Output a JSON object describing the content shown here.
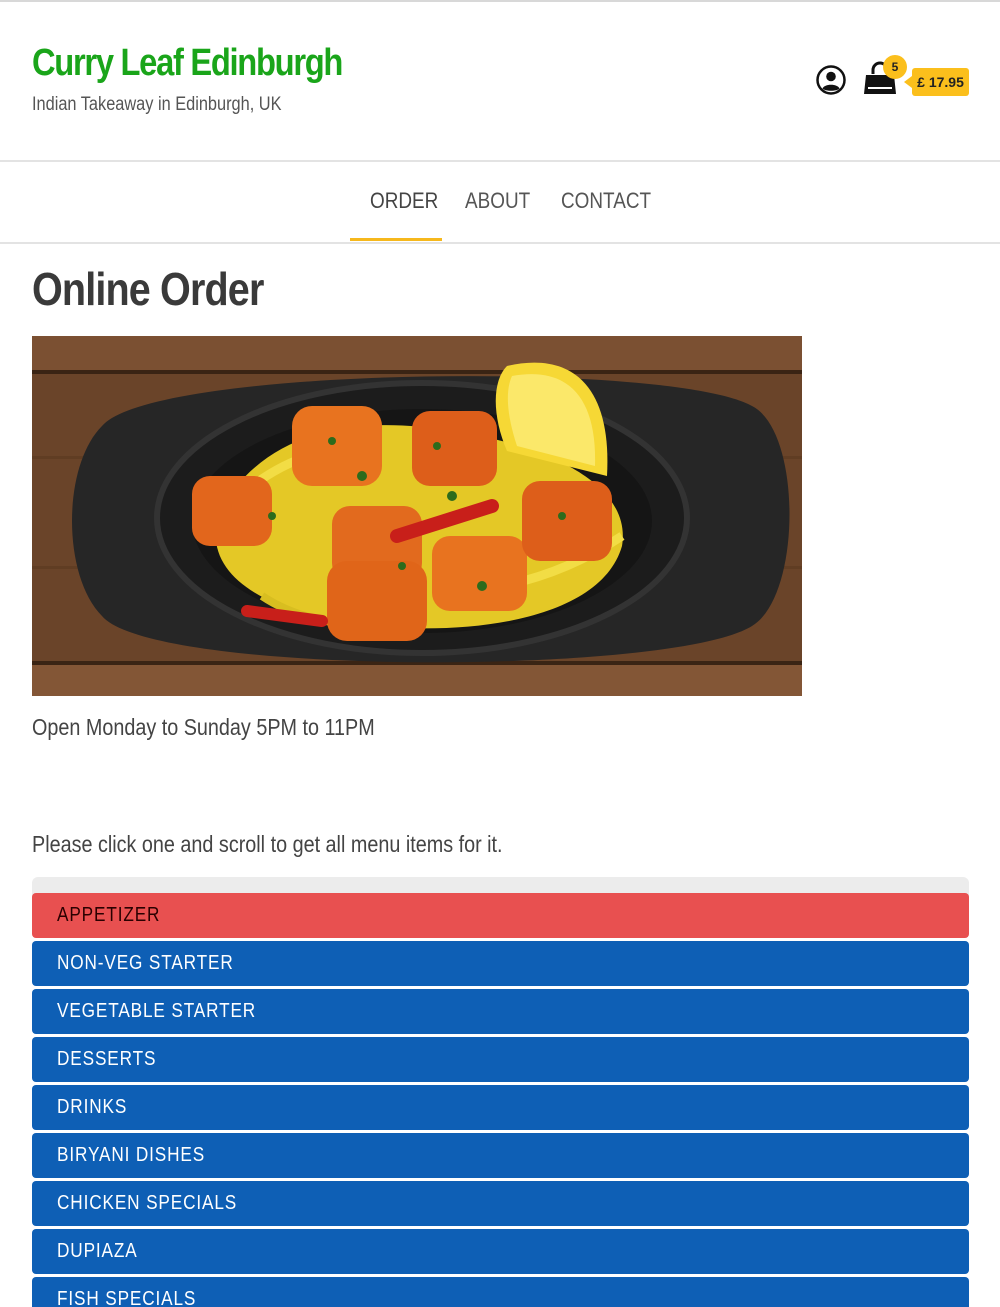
{
  "header": {
    "brand_title": "Curry Leaf Edinburgh",
    "brand_subtitle": "Indian Takeaway in Edinburgh, UK",
    "account_icon": "user-circle-icon",
    "cart_icon": "shopping-bag-icon",
    "cart_count": "5",
    "cart_total": "£ 17.95"
  },
  "nav": {
    "items": [
      "ORDER",
      "ABOUT",
      "CONTACT"
    ],
    "active": "ORDER"
  },
  "main": {
    "page_title": "Online Order",
    "hours": "Open Monday to Sunday 5PM to 11PM",
    "instruction": "Please click one and scroll to get all menu items for it."
  },
  "categories": {
    "items": [
      "APPETIZER",
      "NON-VEG STARTER",
      "VEGETABLE STARTER",
      "DESSERTS",
      "DRINKS",
      "BIRYANI DISHES",
      "CHICKEN SPECIALS",
      "DUPIAZA",
      "FISH SPECIALS"
    ],
    "active": "APPETIZER"
  },
  "colors": {
    "brand_green": "#1aa51a",
    "accent_yellow": "#fbbf1c",
    "category_blue": "#0e5fb5",
    "category_active_red": "#e85050"
  }
}
